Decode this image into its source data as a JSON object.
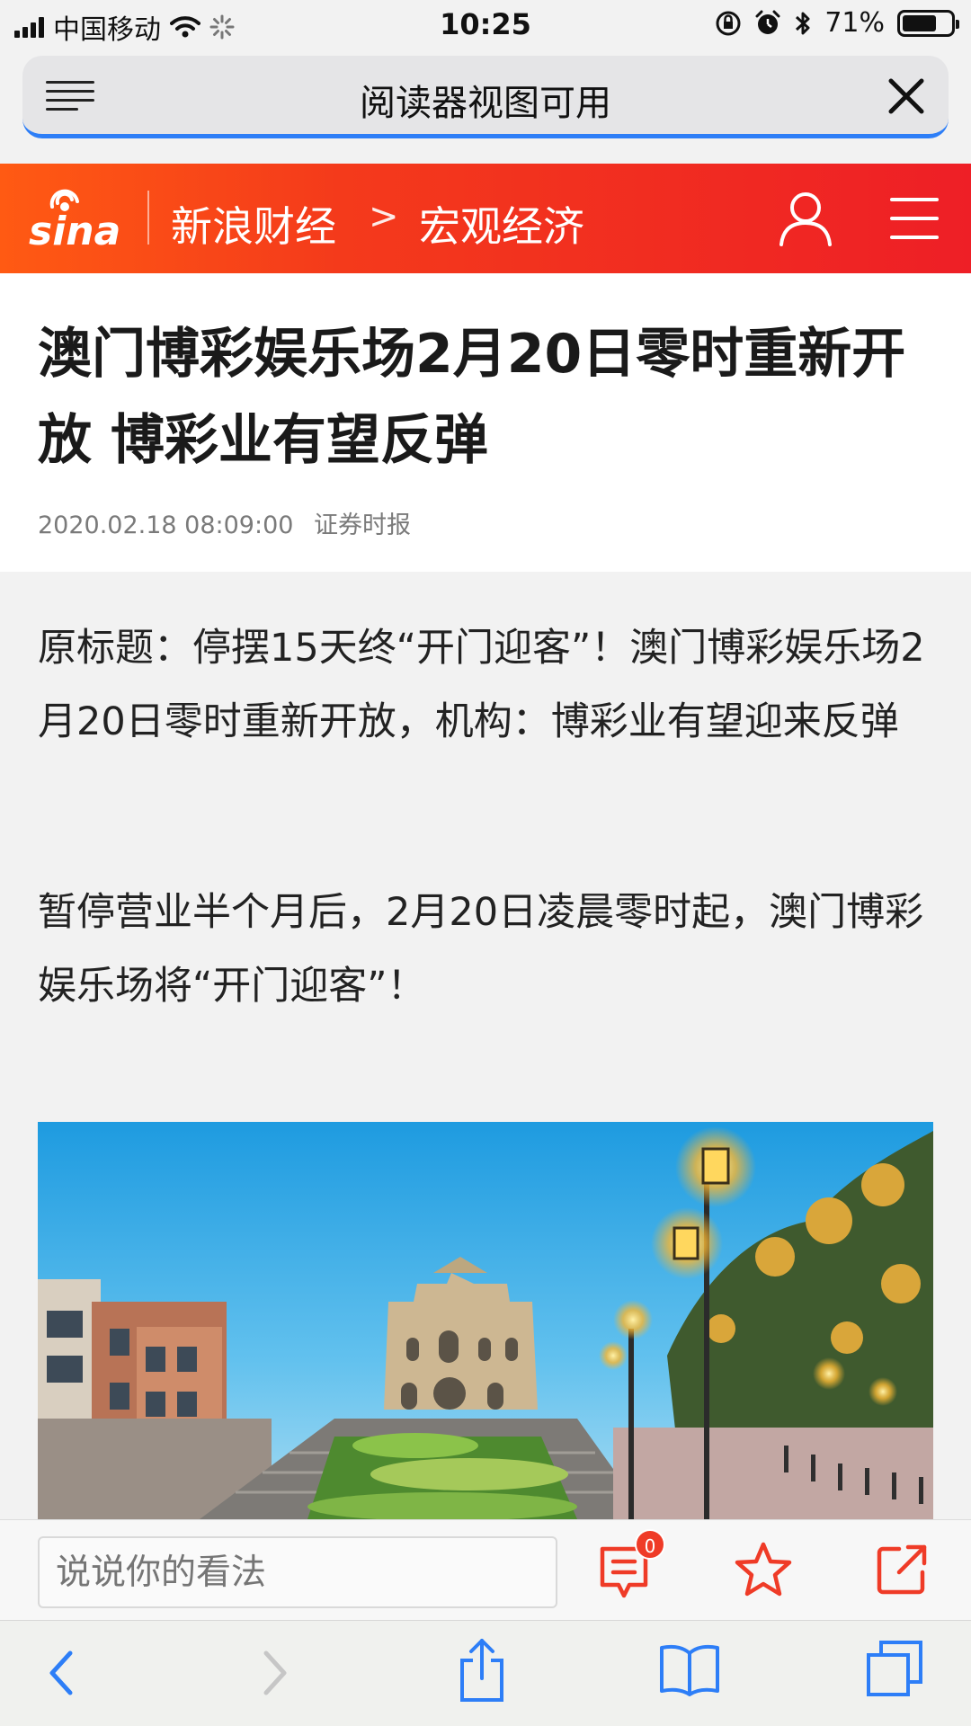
{
  "status_bar": {
    "carrier": "中国移动",
    "time": "10:25",
    "battery_percent": "71%",
    "battery_level": 0.71
  },
  "reader_bar": {
    "title": "阅读器视图可用"
  },
  "site_header": {
    "logo_text": "sina",
    "breadcrumb_section": "新浪财经",
    "breadcrumb_separator": ">",
    "breadcrumb_category": "宏观经济"
  },
  "article": {
    "title": "澳门博彩娱乐场2月20日零时重新开放 博彩业有望反弹",
    "datetime": "2020.02.18 08:09:00",
    "source": "证券时报",
    "paragraphs": [
      "原标题：停摆15天终“开门迎客”！澳门博彩娱乐场2月20日零时重新开放，机构：博彩业有望迎来反弹",
      "暂停营业半个月后，2月20日凌晨零时起，澳门博彩娱乐场将“开门迎客”！"
    ]
  },
  "comment_bar": {
    "input_placeholder": "说说你的看法",
    "comment_count": "0"
  },
  "colors": {
    "brand_orange": "#ff5a13",
    "brand_red": "#ee1f26",
    "accent_icon": "#ef3b27",
    "ios_blue": "#2d7ef7"
  },
  "icons": {
    "reader_menu": "reader-list-icon",
    "reader_close": "close-icon",
    "user": "user-icon",
    "menu": "hamburger-menu-icon",
    "comment": "comment-icon",
    "favorite": "star-icon",
    "share": "share-icon",
    "back": "chevron-left-icon",
    "forward": "chevron-right-icon",
    "safari_share": "safari-share-icon",
    "bookmarks": "book-icon",
    "tabs": "tabs-icon"
  }
}
